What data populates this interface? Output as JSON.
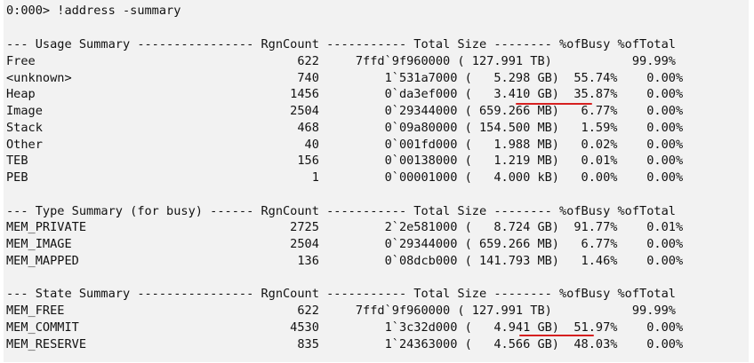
{
  "console": {
    "command": "0:000> !address -summary",
    "usage_summary": {
      "header": "--- Usage Summary ---------------- RgnCount ----------- Total Size -------- %ofBusy %ofTotal",
      "rows": [
        "Free                                    622     7ffd`9f960000 ( 127.991 TB)           99.99%",
        "<unknown>                               740         1`531a7000 (   5.298 GB)  55.74%    0.00%",
        "Heap                                   1456         0`da3ef000 (   3.410 GB)  35.87%    0.00%",
        "Image                                  2504         0`29344000 ( 659.266 MB)   6.77%    0.00%",
        "Stack                                   468         0`09a80000 ( 154.500 MB)   1.59%    0.00%",
        "Other                                    40         0`001fd000 (   1.988 MB)   0.02%    0.00%",
        "TEB                                     156         0`00138000 (   1.219 MB)   0.01%    0.00%",
        "PEB                                       1         0`00001000 (   4.000 kB)   0.00%    0.00%"
      ]
    },
    "type_summary": {
      "header": "--- Type Summary (for busy) ------ RgnCount ----------- Total Size -------- %ofBusy %ofTotal",
      "rows": [
        "MEM_PRIVATE                            2725         2`2e581000 (   8.724 GB)  91.77%    0.01%",
        "MEM_IMAGE                              2504         0`29344000 ( 659.266 MB)   6.77%    0.00%",
        "MEM_MAPPED                              136         0`08dcb000 ( 141.793 MB)   1.46%    0.00%"
      ]
    },
    "state_summary": {
      "header": "--- State Summary ---------------- RgnCount ----------- Total Size -------- %ofBusy %ofTotal",
      "rows": [
        "MEM_FREE                                622     7ffd`9f960000 ( 127.991 TB)           99.99%",
        "MEM_COMMIT                             4530         1`3c32d000 (   4.941 GB)  51.97%    0.00%",
        "MEM_RESERVE                             835         1`24363000 (   4.566 GB)  48.03%    0.00%"
      ]
    }
  },
  "colors": {
    "background": "#f2f2f2",
    "text": "#111111",
    "annotation_underline": "#d62020"
  }
}
